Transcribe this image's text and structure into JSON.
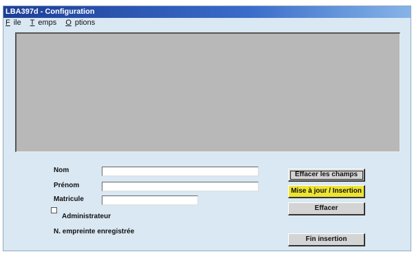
{
  "window": {
    "title": "LBA397d - Configuration"
  },
  "menu": {
    "file": {
      "accel": "F",
      "rest": "ile"
    },
    "temps": {
      "accel": "T",
      "rest": "emps"
    },
    "options": {
      "accel": "O",
      "rest": "ptions"
    }
  },
  "form": {
    "nom_label": "Nom",
    "nom_value": "",
    "prenom_label": "Prénom",
    "prenom_value": "",
    "matricule_label": "Matricule",
    "matricule_value": "",
    "administrateur_label": "Administrateur",
    "administrateur_checked": false,
    "empreinte_label": "N. empreinte enregistrée"
  },
  "buttons": {
    "effacer_champs": "Effacer les champs",
    "mise_a_jour": "Mise à jour / Insertion",
    "effacer": "Effacer",
    "fin_insertion": "Fin insertion"
  },
  "colors": {
    "window_bg": "#d9e8f3",
    "panel": "#b8b8b8",
    "button": "#d4d4d4",
    "highlight_button": "#eee433",
    "title_gradient_start": "#1d3f97"
  }
}
